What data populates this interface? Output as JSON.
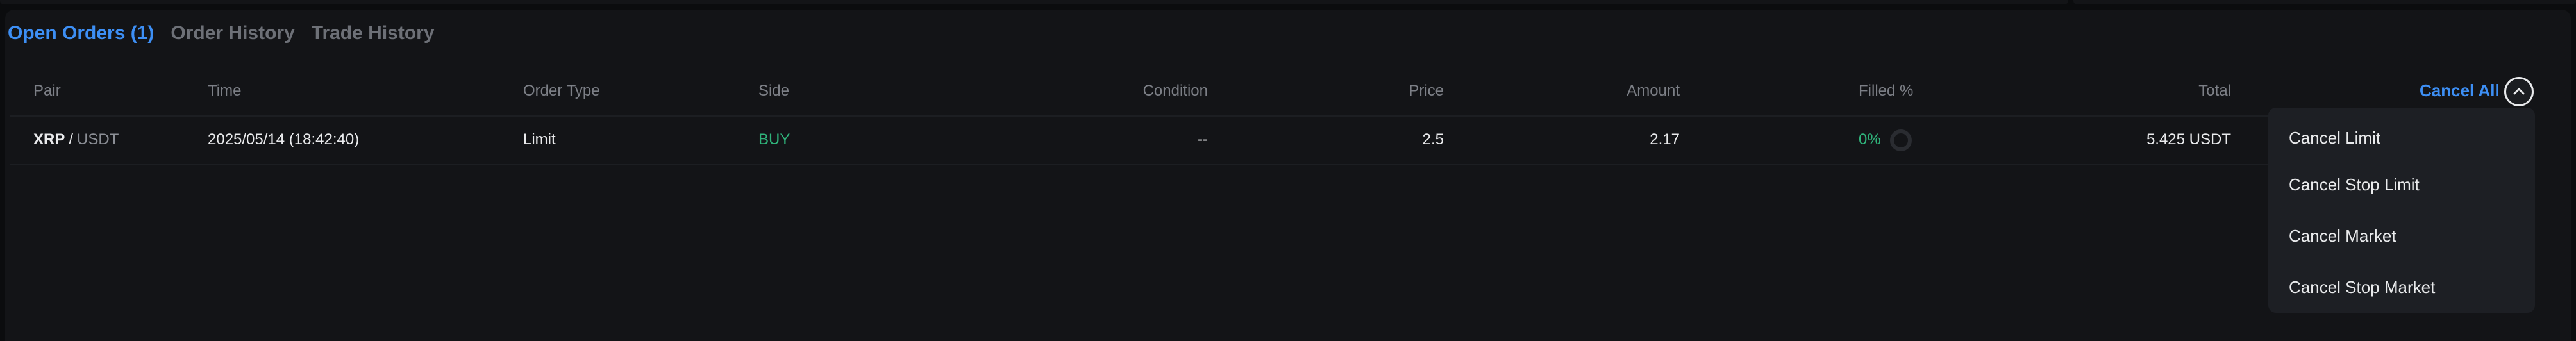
{
  "tabs": [
    {
      "label": "Open Orders (1)",
      "active": true
    },
    {
      "label": "Order History",
      "active": false
    },
    {
      "label": "Trade History",
      "active": false
    }
  ],
  "table": {
    "headers": {
      "pair": "Pair",
      "time": "Time",
      "order_type": "Order Type",
      "side": "Side",
      "condition": "Condition",
      "price": "Price",
      "amount": "Amount",
      "filled": "Filled %",
      "total": "Total"
    },
    "rows": [
      {
        "pair_base": "XRP",
        "pair_sep": "/",
        "pair_quote": "USDT",
        "time": "2025/05/14 (18:42:40)",
        "order_type": "Limit",
        "side": "BUY",
        "condition": "--",
        "price": "2.5",
        "amount": "2.17",
        "filled": "0%",
        "filled_fraction": 0,
        "total": "5.425 USDT"
      }
    ]
  },
  "cancel_all": {
    "label": "Cancel All",
    "expanded": true,
    "menu": [
      "Cancel Limit",
      "Cancel Stop Limit",
      "Cancel Market",
      "Cancel Stop Market"
    ]
  },
  "icons": {
    "cancel_all_toggle": "chevron-up-icon",
    "filled_progress": "progress-ring-icon"
  },
  "colors": {
    "accent": "#3d8ff5",
    "buy": "#2fb37a",
    "background": "#131417"
  }
}
